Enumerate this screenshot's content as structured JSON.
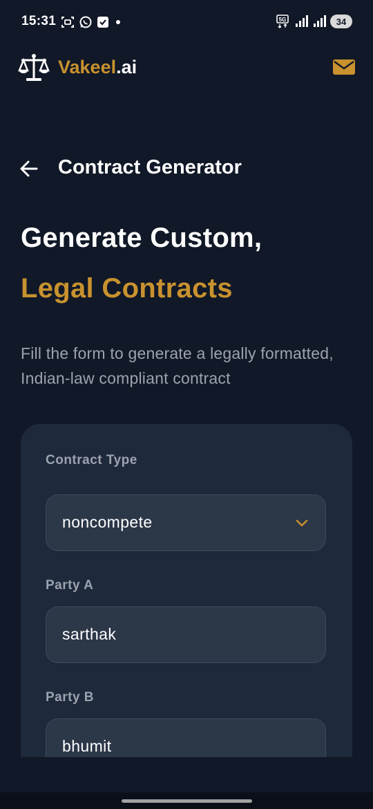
{
  "status_bar": {
    "time": "15:31",
    "network_label": "5G",
    "battery": "34",
    "left_icons": [
      "screenshot-icon",
      "whatsapp-icon",
      "check-icon",
      "dot-icon"
    ],
    "right_icons": [
      "network-icon",
      "signal-icon",
      "signal-icon",
      "battery-icon"
    ]
  },
  "header": {
    "brand_primary": "Vakeel",
    "brand_secondary": ".ai",
    "logo_icon": "scales-icon",
    "mail_icon": "mail-icon"
  },
  "page": {
    "title": "Contract Generator",
    "back_icon": "arrow-left-icon"
  },
  "hero": {
    "line1": "Generate Custom,",
    "line2": "Legal Contracts",
    "description": "Fill the form to generate a legally formatted, Indian-law compliant contract"
  },
  "form": {
    "contract_type": {
      "label": "Contract Type",
      "value": "noncompete"
    },
    "party_a": {
      "label": "Party A",
      "value": "sarthak"
    },
    "party_b": {
      "label": "Party B",
      "value": "bhumit"
    }
  },
  "colors": {
    "background": "#111827",
    "accent": "#c8922f",
    "card": "#1e293b",
    "input": "#2c3748",
    "muted_text": "#9ca3af"
  }
}
